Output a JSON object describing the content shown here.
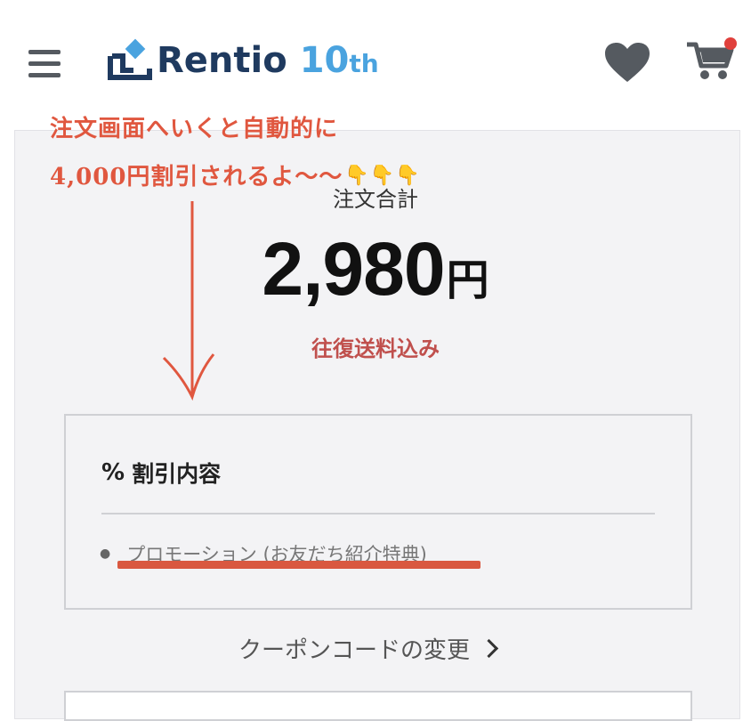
{
  "header": {
    "logo_text": "Rentio",
    "logo_anniversary": "10",
    "logo_anniversary_suffix": "th"
  },
  "annotation": {
    "line1": "注文画面へいくと自動的に",
    "line2": "4,000円割引されるよ〜〜",
    "emoji": "👇👇👇",
    "color": "#e0573f"
  },
  "order": {
    "total_label": "注文合計",
    "total_amount": "2,980",
    "currency": "円",
    "shipping_note": "往復送料込み"
  },
  "discount": {
    "icon": "percent-icon",
    "icon_glyph": "%",
    "title": "割引内容",
    "items": [
      {
        "label": "プロモーション (お友だち紹介特典)"
      }
    ]
  },
  "coupon": {
    "change_label": "クーポンコードの変更"
  },
  "colors": {
    "brand_navy": "#1f3a5f",
    "brand_blue": "#4aa3df",
    "accent_red": "#c0504d",
    "cart_badge": "#e0403c"
  }
}
